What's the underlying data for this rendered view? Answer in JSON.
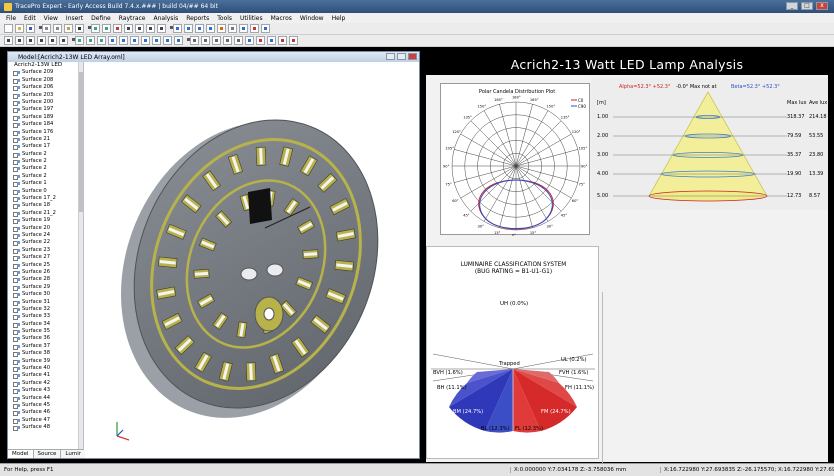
{
  "window": {
    "title": "TracePro Expert - Early Access Build 7.4.x.###  | build 04/## 64 bit",
    "controls": [
      "_",
      "□",
      "x"
    ]
  },
  "menu": [
    "File",
    "Edit",
    "View",
    "Insert",
    "Define",
    "Raytrace",
    "Analysis",
    "Reports",
    "Tools",
    "Utilities",
    "Macros",
    "Window",
    "Help"
  ],
  "model_window": {
    "title": "Model:[Acrich2-13W LED Array.oml]",
    "tree_root": "Acrich2-13W LED",
    "tree_items": [
      "Surface 209",
      "Surface 208",
      "Surface 206",
      "Surface 203",
      "Surface 200",
      "Surface 197",
      "Surface 189",
      "Surface 184",
      "Surface 176",
      "Surface 21",
      "Surface 17",
      "Surface 2",
      "Surface 2",
      "Surface 2",
      "Surface 2",
      "Surface 1",
      "Surface 0",
      "Surface 17_2",
      "Surface 18",
      "Surface 21_2",
      "Surface 19",
      "Surface 20",
      "Surface 24",
      "Surface 22",
      "Surface 23",
      "Surface 27",
      "Surface 25",
      "Surface 26",
      "Surface 28",
      "Surface 29",
      "Surface 30",
      "Surface 31",
      "Surface 32",
      "Surface 33",
      "Surface 34",
      "Surface 35",
      "Surface 36",
      "Surface 37",
      "Surface 38",
      "Surface 39",
      "Surface 40",
      "Surface 41",
      "Surface 42",
      "Surface 43",
      "Surface 44",
      "Surface 45",
      "Surface 46",
      "Surface 47",
      "Surface 48"
    ],
    "tabs": [
      "Model",
      "Source",
      "Lumir"
    ]
  },
  "status": {
    "help": "For Help, press F1",
    "coords": "X:0.000000 Y:7.034178 Z:-3.758036 mm",
    "coords2": "X:16.722980 Y:27.693835 Z:-26.175570; X:16.722980 Y:27.693835 Z:-26.175570; X:16.722980 Y:27.693835 Z:-26.175570"
  },
  "analysis": {
    "title": "Acrich2-13 Watt LED Lamp  Analysis",
    "polar": {
      "title": "Polar Candela Distribution Plot",
      "angle_labels": [
        "180°",
        "165°",
        "150°",
        "135°",
        "120°",
        "105°",
        "90°",
        "75°",
        "60°",
        "45°",
        "30°",
        "15°",
        "0°"
      ],
      "legend": [
        "C0",
        "C90"
      ]
    },
    "cone": {
      "alpha": "Alpha=52.3° +52.3°",
      "center": "-0.0°  Max not at",
      "beta": "Beta=52.3° +52.3°",
      "unit": "[m]",
      "col_max": "Max lux",
      "col_ave": "Ave lux",
      "rows": [
        {
          "dist": "1.00",
          "max": "318.37",
          "ave": "214.18"
        },
        {
          "dist": "2.00",
          "max": "79.59",
          "ave": "53.55"
        },
        {
          "dist": "3.00",
          "max": "35.37",
          "ave": "23.80"
        },
        {
          "dist": "4.00",
          "max": "19.90",
          "ave": "13.39"
        },
        {
          "dist": "5.00",
          "max": "12.73",
          "ave": "8.57"
        }
      ]
    },
    "bug": {
      "title1": "LUMINAIRE CLASSIFICATION SYSTEM",
      "title2": "(BUG RATING = B1-U1-G1)",
      "uh": "UH (0.0%)",
      "trapped": "Trapped",
      "ul": "UL (0.2%)",
      "bvh": "BVH (1.6%)",
      "fvh": "FVH (1.6%)",
      "bh": "BH (11.1%)",
      "fh": "FH (11.1%)",
      "bm": "BM (24.7%)",
      "fm": "FM (24.7%)",
      "bl": "BL (12.3%)",
      "fl": "FL (12.3%)"
    }
  }
}
